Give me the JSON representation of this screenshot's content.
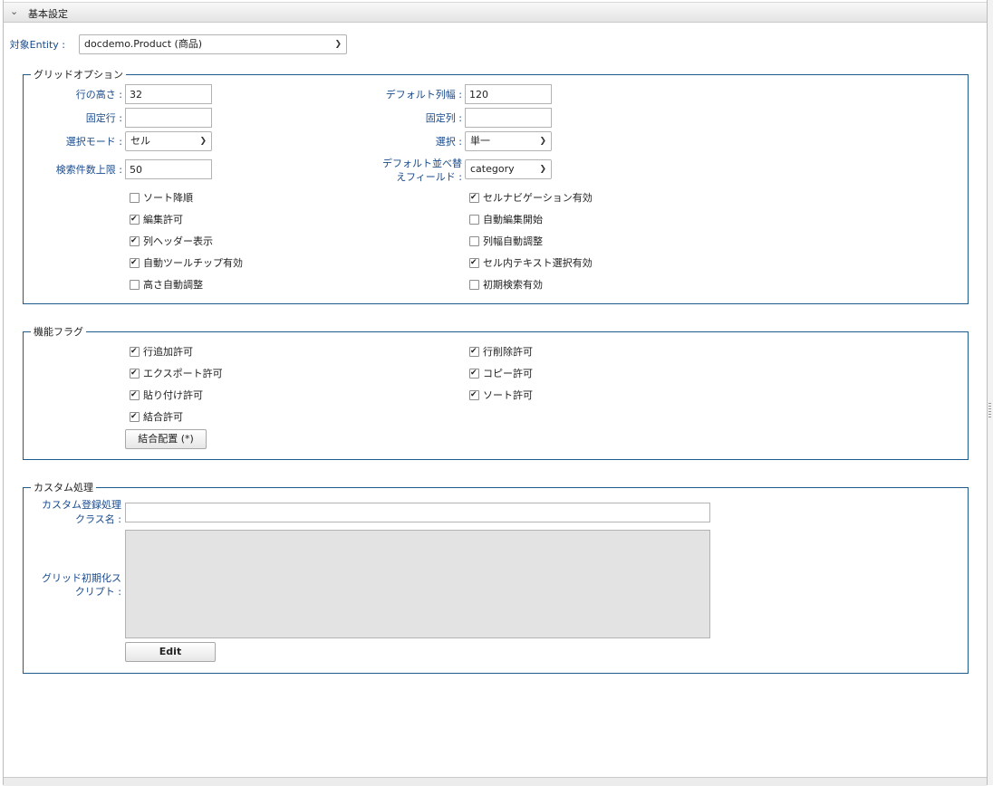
{
  "header": {
    "title": "基本設定"
  },
  "entity": {
    "label": "対象Entity :",
    "value": "docdemo.Product (商品)"
  },
  "grid_options": {
    "legend": "グリッドオプション",
    "row_height": {
      "label": "行の高さ :",
      "value": "32"
    },
    "default_col_width": {
      "label": "デフォルト列幅 :",
      "value": "120"
    },
    "fixed_rows": {
      "label": "固定行 :",
      "value": ""
    },
    "fixed_cols": {
      "label": "固定列 :",
      "value": ""
    },
    "select_mode": {
      "label": "選択モード :",
      "value": "セル"
    },
    "selection": {
      "label": "選択 :",
      "value": "単一"
    },
    "search_limit": {
      "label": "検索件数上限 :",
      "value": "50"
    },
    "default_sort_field": {
      "label_line1": "デフォルト並べ替",
      "label_line2": "えフィールド :",
      "value": "category"
    },
    "checks_left": [
      {
        "label": "ソート降順",
        "checked": false
      },
      {
        "label": "編集許可",
        "checked": true
      },
      {
        "label": "列ヘッダー表示",
        "checked": true
      },
      {
        "label": "自動ツールチップ有効",
        "checked": true
      },
      {
        "label": "高さ自動調整",
        "checked": false
      }
    ],
    "checks_right": [
      {
        "label": "セルナビゲーション有効",
        "checked": true
      },
      {
        "label": "自動編集開始",
        "checked": false
      },
      {
        "label": "列幅自動調整",
        "checked": false
      },
      {
        "label": "セル内テキスト選択有効",
        "checked": true
      },
      {
        "label": "初期検索有効",
        "checked": false
      }
    ]
  },
  "feature_flags": {
    "legend": "機能フラグ",
    "checks_left": [
      {
        "label": "行追加許可",
        "checked": true
      },
      {
        "label": "エクスポート許可",
        "checked": true
      },
      {
        "label": "貼り付け許可",
        "checked": true
      },
      {
        "label": "結合許可",
        "checked": true
      }
    ],
    "checks_right": [
      {
        "label": "行削除許可",
        "checked": true
      },
      {
        "label": "コピー許可",
        "checked": true
      },
      {
        "label": "ソート許可",
        "checked": true
      }
    ],
    "merge_button": "結合配置 (*)"
  },
  "custom": {
    "legend": "カスタム処理",
    "class_label_line1": "カスタム登録処理",
    "class_label_line2": "クラス名 :",
    "class_value": "",
    "script_label_line1": "グリッド初期化ス",
    "script_label_line2": "クリプト :",
    "edit_button": "Edit"
  }
}
